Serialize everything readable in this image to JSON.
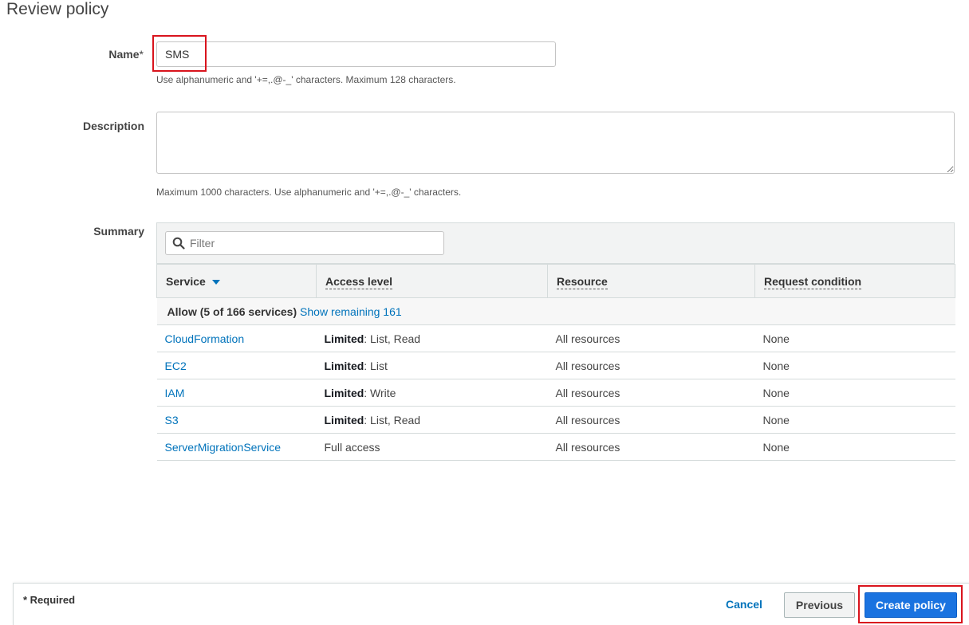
{
  "page": {
    "title": "Review policy"
  },
  "name_field": {
    "label": "Name",
    "required_marker": "*",
    "value": "SMS",
    "hint": "Use alphanumeric and '+=,.@-_' characters. Maximum 128 characters."
  },
  "description_field": {
    "label": "Description",
    "value": "",
    "hint": "Maximum 1000 characters. Use alphanumeric and '+=,.@-_' characters."
  },
  "summary": {
    "label": "Summary",
    "filter_placeholder": "Filter",
    "columns": {
      "service": "Service",
      "access_level": "Access level",
      "resource": "Resource",
      "request_condition": "Request condition"
    },
    "group": {
      "label": "Allow (5 of 166 services)",
      "show_remaining": "Show remaining 161"
    },
    "rows": [
      {
        "service": "CloudFormation",
        "access_bold": "Limited",
        "access_rest": ": List, Read",
        "resource": "All resources",
        "condition": "None"
      },
      {
        "service": "EC2",
        "access_bold": "Limited",
        "access_rest": ": List",
        "resource": "All resources",
        "condition": "None"
      },
      {
        "service": "IAM",
        "access_bold": "Limited",
        "access_rest": ": Write",
        "resource": "All resources",
        "condition": "None"
      },
      {
        "service": "S3",
        "access_bold": "Limited",
        "access_rest": ": List, Read",
        "resource": "All resources",
        "condition": "None"
      },
      {
        "service": "ServerMigrationService",
        "access_bold": "",
        "access_rest": "Full access",
        "resource": "All resources",
        "condition": "None"
      }
    ]
  },
  "footer": {
    "required_note": "* Required",
    "cancel": "Cancel",
    "previous": "Previous",
    "create": "Create policy"
  },
  "colors": {
    "link": "#0073bb",
    "primary_button": "#1a73e0",
    "highlight": "#d9141d"
  },
  "icons": {
    "filter": "search-icon",
    "sort": "caret-down-icon"
  }
}
